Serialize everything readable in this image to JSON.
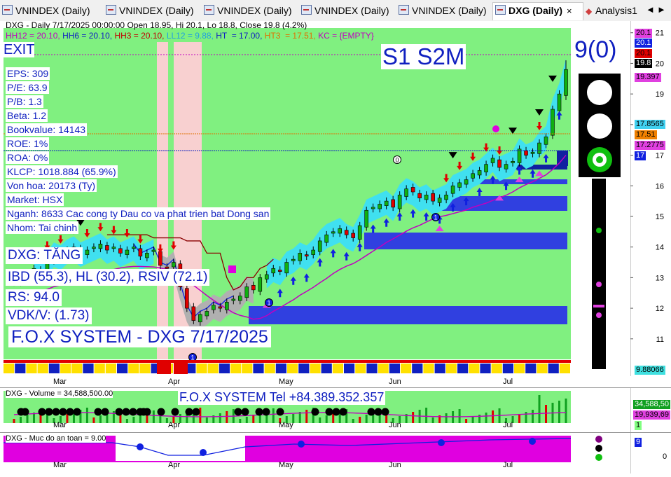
{
  "tabs": [
    {
      "label": "VNINDEX (Daily)",
      "active": false
    },
    {
      "label": "VNINDEX (Daily)",
      "active": false
    },
    {
      "label": "VNINDEX (Daily)",
      "active": false
    },
    {
      "label": "VNINDEX (Daily)",
      "active": false
    },
    {
      "label": "VNINDEX (Daily)",
      "active": false
    },
    {
      "label": "DXG (Daily)",
      "active": true
    },
    {
      "label": "Analysis1",
      "active": false
    }
  ],
  "tab_close": "×",
  "nav": {
    "prev": "◄",
    "next": "►"
  },
  "price_panel": {
    "header1": "DXG - Daily 7/17/2025 00:00:00 Open 18.95, Hi 20.1, Lo 18.8, Close 19.8 (4.2%)",
    "header2": [
      {
        "text": "HH12 = 20.10, ",
        "color": "#c000c0"
      },
      {
        "text": "HH6 = 20.10, ",
        "color": "#1020c0"
      },
      {
        "text": "HH3 = 20.10, ",
        "color": "#c00000"
      },
      {
        "text": "LL12 = 9.88, ",
        "color": "#20a0e0"
      },
      {
        "text": "HT  = 17.00, ",
        "color": "#1020c0"
      },
      {
        "text": "HT3  = 17.51, ",
        "color": "#e07000"
      },
      {
        "text": "KC = {EMPTY}",
        "color": "#c000c0"
      }
    ],
    "exit_label": "EXIT",
    "signal_label": "S1  S2M",
    "count_label": "9(0)",
    "fundamentals": [
      "EPS: 309",
      "P/E: 63.9",
      "P/B: 1.3",
      "Beta: 1.2",
      "Bookvalue: 14143",
      "ROE: 1%",
      "ROA: 0%",
      "KLCP: 1018.884 (65.9%)",
      "Von hoa: 20173 (Ty)",
      "Market: HSX",
      "Nganh: 8633 Cac cong ty Dau co va phat trien bat Dong san",
      "Nhom: Tai chinh"
    ],
    "status": "DXG: TĂNG",
    "ibd": "IBD (55.3), HL (30.2), RSIV (72.1)",
    "rs": "RS: 94.0",
    "vdk": "VDK/V:  (1.73)",
    "system": "F.O.X SYSTEM - DXG 7/17/2025",
    "right_labels": [
      {
        "text": "20.1",
        "bg": "#e040e0",
        "fg": "#000"
      },
      {
        "text": "20.1",
        "bg": "#1020e0",
        "fg": "#fff"
      },
      {
        "text": "20.1",
        "bg": "#e00000",
        "fg": "#000"
      },
      {
        "text": "19.8",
        "bg": "#000000",
        "fg": "#fff"
      },
      {
        "text": "19.397",
        "bg": "#e040e0",
        "fg": "#000"
      },
      {
        "text": "17.8565",
        "bg": "#40d0f0",
        "fg": "#000"
      },
      {
        "text": "17.51",
        "bg": "#f08000",
        "fg": "#000"
      },
      {
        "text": "17.2775",
        "bg": "#e040e0",
        "fg": "#000"
      },
      {
        "text": "17",
        "bg": "#1020e0",
        "fg": "#fff"
      },
      {
        "text": "9.88066",
        "bg": "#40e0e0",
        "fg": "#000"
      }
    ],
    "y_ticks": [
      "21",
      "20",
      "19",
      "18",
      "17",
      "16",
      "15",
      "14",
      "13",
      "12",
      "11"
    ]
  },
  "volume_panel": {
    "header": "DXG - Volume = 34,588,500.00",
    "tel": "F.O.X SYSTEM Tel +84.389.352.357",
    "right_labels": [
      {
        "text": "34,588,50",
        "bg": "#10a020",
        "fg": "#fff"
      },
      {
        "text": "19,939,69",
        "bg": "#e040e0",
        "fg": "#000"
      },
      {
        "text": "1",
        "bg": "#80ff80",
        "fg": "#000"
      }
    ]
  },
  "safety_panel": {
    "header": "DXG - Muc do an toan = 9.00",
    "right_label": "9",
    "zero_tick": "0"
  },
  "month_labels": [
    "Mar",
    "Apr",
    "May",
    "Jun",
    "Jul"
  ],
  "chart_data": {
    "type": "candlestick",
    "ylim": [
      10.4,
      21.2
    ],
    "dates_range": [
      "2025-02-24",
      "2025-07-17"
    ],
    "last_bar": {
      "date": "2025-07-17",
      "open": 18.95,
      "high": 20.1,
      "low": 18.8,
      "close": 19.8,
      "change_pct": 4.2
    },
    "closes": [
      12.9,
      13.0,
      13.1,
      13.3,
      13.2,
      13.5,
      13.8,
      13.7,
      13.9,
      14.0,
      13.8,
      13.9,
      14.0,
      14.1,
      13.9,
      14.0,
      13.8,
      13.9,
      14.0,
      13.7,
      13.8,
      13.9,
      13.4,
      13.3,
      13.5,
      12.7,
      12.0,
      11.6,
      11.8,
      11.9,
      12.1,
      12.0,
      12.2,
      12.3,
      12.4,
      12.7,
      12.6,
      13.0,
      13.1,
      13.3,
      13.2,
      13.5,
      13.6,
      13.8,
      13.7,
      13.9,
      14.2,
      14.4,
      14.5,
      14.6,
      14.4,
      14.3,
      14.7,
      15.2,
      15.3,
      15.4,
      15.5,
      15.3,
      15.7,
      15.9,
      15.8,
      15.6,
      15.7,
      15.5,
      15.6,
      15.7,
      16.0,
      16.1,
      16.2,
      16.4,
      16.5,
      16.7,
      16.9,
      16.6,
      16.7,
      16.8,
      17.2,
      17.0,
      17.1,
      17.4,
      17.6,
      18.5,
      19.0,
      19.8
    ],
    "volume_last": 34588500,
    "volume_ma": 19939690,
    "safety_level": 9
  }
}
